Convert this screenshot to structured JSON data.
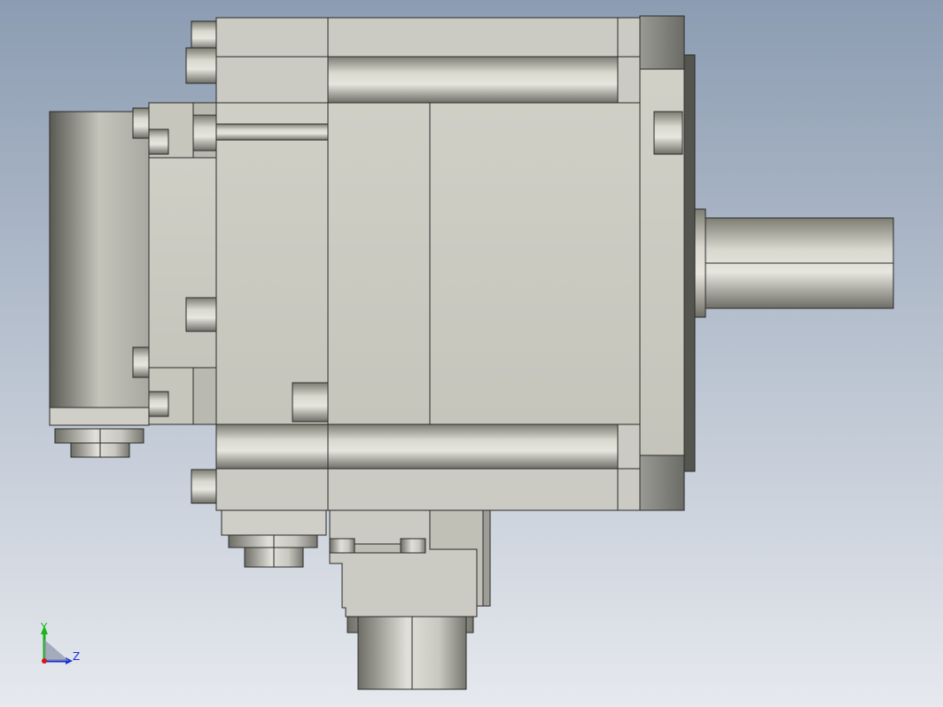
{
  "colors": {
    "bg_top": "#93a3b8",
    "bg_bottom": "#e3e7ec",
    "body_face": "#cdcdc5",
    "body_dark": "#8f8f88",
    "edge": "#2a2a2a",
    "axis_x": "#d01818",
    "axis_y": "#19b419",
    "axis_z": "#1a2fd6"
  },
  "triad": {
    "y_label": "Y",
    "z_label": "Z"
  },
  "model": {
    "description_icon": "servo-motor-side-view-icon"
  }
}
